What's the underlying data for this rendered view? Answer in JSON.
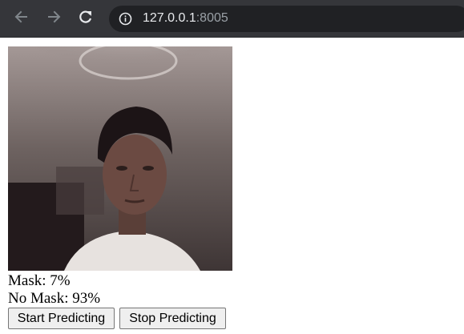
{
  "browser": {
    "url_host": "127.0.0.1",
    "url_port": ":8005",
    "icons": {
      "back": "arrow-left-icon",
      "forward": "arrow-right-icon",
      "reload": "reload-icon",
      "site_info": "info-icon"
    }
  },
  "webcam": {
    "content": "live webcam feed image"
  },
  "predictions": {
    "mask": "Mask: 7%",
    "no_mask": "No Mask: 93%"
  },
  "buttons": {
    "start": "Start Predicting",
    "stop": "Stop Predicting"
  },
  "colors": {
    "toolbar_bg": "#35363a",
    "omnibox_bg": "#202124",
    "button_bg": "#efefef"
  }
}
